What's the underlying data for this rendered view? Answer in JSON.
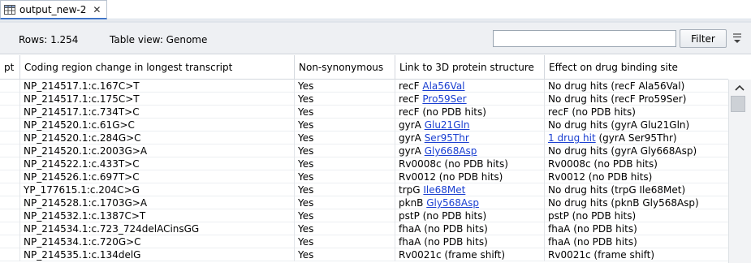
{
  "tab": {
    "title": "output_new-2",
    "close_glyph": "✕",
    "icon": "table-icon"
  },
  "infobar": {
    "rows_text": "Rows: 1.254",
    "view_text": "Table view: Genome",
    "search_value": "",
    "search_placeholder": "",
    "filter_label": "Filter",
    "menu_icon": "menu-icon"
  },
  "table": {
    "headers": [
      "pt",
      "Coding region change in longest transcript",
      "Non-synonymous",
      "Link to 3D protein structure",
      "Effect on drug binding site"
    ],
    "rows": [
      {
        "coding": "NP_214517.1:c.167C>T",
        "nonsyn": "Yes",
        "link_pre": "recF ",
        "link_text": "Ala56Val",
        "link_post": "",
        "effect_pre": "No drug hits (recF Ala56Val)",
        "effect_link": "",
        "effect_post": ""
      },
      {
        "coding": "NP_214517.1:c.175C>T",
        "nonsyn": "Yes",
        "link_pre": "recF ",
        "link_text": "Pro59Ser",
        "link_post": "",
        "effect_pre": "No drug hits (recF Pro59Ser)",
        "effect_link": "",
        "effect_post": ""
      },
      {
        "coding": "NP_214517.1:c.734T>C",
        "nonsyn": "Yes",
        "link_pre": "recF (no PDB hits)",
        "link_text": "",
        "link_post": "",
        "effect_pre": "recF (no PDB hits)",
        "effect_link": "",
        "effect_post": ""
      },
      {
        "coding": "NP_214520.1:c.61G>C",
        "nonsyn": "Yes",
        "link_pre": "gyrA ",
        "link_text": "Glu21Gln",
        "link_post": "",
        "effect_pre": "No drug hits (gyrA Glu21Gln)",
        "effect_link": "",
        "effect_post": ""
      },
      {
        "coding": "NP_214520.1:c.284G>C",
        "nonsyn": "Yes",
        "link_pre": "gyrA ",
        "link_text": "Ser95Thr",
        "link_post": "",
        "effect_pre": "",
        "effect_link": "1 drug hit",
        "effect_post": " (gyrA Ser95Thr)"
      },
      {
        "coding": "NP_214520.1:c.2003G>A",
        "nonsyn": "Yes",
        "link_pre": "gyrA ",
        "link_text": "Gly668Asp",
        "link_post": "",
        "effect_pre": "No drug hits (gyrA Gly668Asp)",
        "effect_link": "",
        "effect_post": ""
      },
      {
        "coding": "NP_214522.1:c.433T>C",
        "nonsyn": "Yes",
        "link_pre": "Rv0008c (no PDB hits)",
        "link_text": "",
        "link_post": "",
        "effect_pre": "Rv0008c (no PDB hits)",
        "effect_link": "",
        "effect_post": ""
      },
      {
        "coding": "NP_214526.1:c.697T>C",
        "nonsyn": "Yes",
        "link_pre": "Rv0012 (no PDB hits)",
        "link_text": "",
        "link_post": "",
        "effect_pre": "Rv0012 (no PDB hits)",
        "effect_link": "",
        "effect_post": ""
      },
      {
        "coding": "YP_177615.1:c.204C>G",
        "nonsyn": "Yes",
        "link_pre": "trpG ",
        "link_text": "Ile68Met",
        "link_post": "",
        "effect_pre": "No drug hits (trpG Ile68Met)",
        "effect_link": "",
        "effect_post": ""
      },
      {
        "coding": "NP_214528.1:c.1703G>A",
        "nonsyn": "Yes",
        "link_pre": "pknB ",
        "link_text": "Gly568Asp",
        "link_post": "",
        "effect_pre": "No drug hits (pknB Gly568Asp)",
        "effect_link": "",
        "effect_post": ""
      },
      {
        "coding": "NP_214532.1:c.1387C>T",
        "nonsyn": "Yes",
        "link_pre": "pstP (no PDB hits)",
        "link_text": "",
        "link_post": "",
        "effect_pre": "pstP (no PDB hits)",
        "effect_link": "",
        "effect_post": ""
      },
      {
        "coding": "NP_214534.1:c.723_724delACinsGG",
        "nonsyn": "Yes",
        "link_pre": "fhaA (no PDB hits)",
        "link_text": "",
        "link_post": "",
        "effect_pre": "fhaA (no PDB hits)",
        "effect_link": "",
        "effect_post": ""
      },
      {
        "coding": "NP_214534.1:c.720G>C",
        "nonsyn": "Yes",
        "link_pre": "fhaA (no PDB hits)",
        "link_text": "",
        "link_post": "",
        "effect_pre": "fhaA (no PDB hits)",
        "effect_link": "",
        "effect_post": ""
      },
      {
        "coding": "NP_214535.1:c.134delG",
        "nonsyn": "Yes",
        "link_pre": "Rv0021c (frame shift)",
        "link_text": "",
        "link_post": "",
        "effect_pre": "Rv0021c (frame shift)",
        "effect_link": "",
        "effect_post": ""
      }
    ]
  },
  "colors": {
    "link": "#1a3fd1",
    "tab_accent": "#3e73c7"
  }
}
